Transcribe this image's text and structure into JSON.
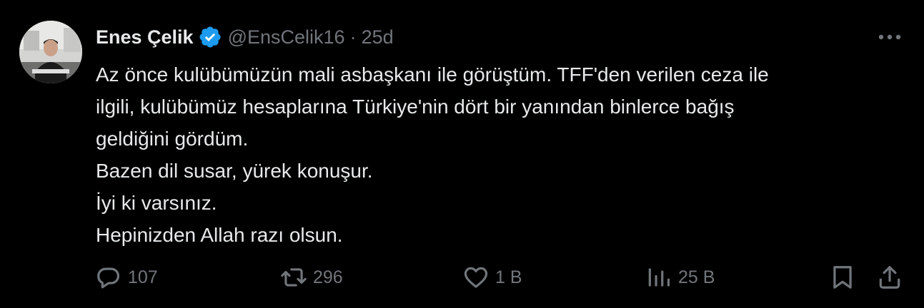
{
  "user": {
    "name": "Enes Çelik",
    "handle": "@EnsCelik16",
    "separator": "·",
    "time": "25d",
    "verified_color": "#1d9bf0"
  },
  "tweet": {
    "lines": [
      "Az önce kulübümüzün mali asbaşkanı ile görüştüm. TFF'den verilen ceza ile",
      "ilgili, kulübümüz hesaplarına Türkiye'nin dört bir yanından binlerce bağış",
      "geldiğini gördüm.",
      "Bazen dil susar, yürek konuşur.",
      "İyi ki varsınız.",
      "Hepinizden Allah razı olsun."
    ]
  },
  "actions": {
    "reply": {
      "icon": "reply-icon",
      "count": "107"
    },
    "retweet": {
      "icon": "retweet-icon",
      "count": "296"
    },
    "like": {
      "icon": "heart-icon",
      "count": "1 B"
    },
    "views": {
      "icon": "analytics-icon",
      "count": "25 B"
    },
    "bookmark": {
      "icon": "bookmark-icon"
    },
    "share": {
      "icon": "share-icon"
    }
  },
  "colors": {
    "background": "#000000",
    "text": "#e7e9ea",
    "muted": "#71767b",
    "accent": "#1d9bf0"
  }
}
